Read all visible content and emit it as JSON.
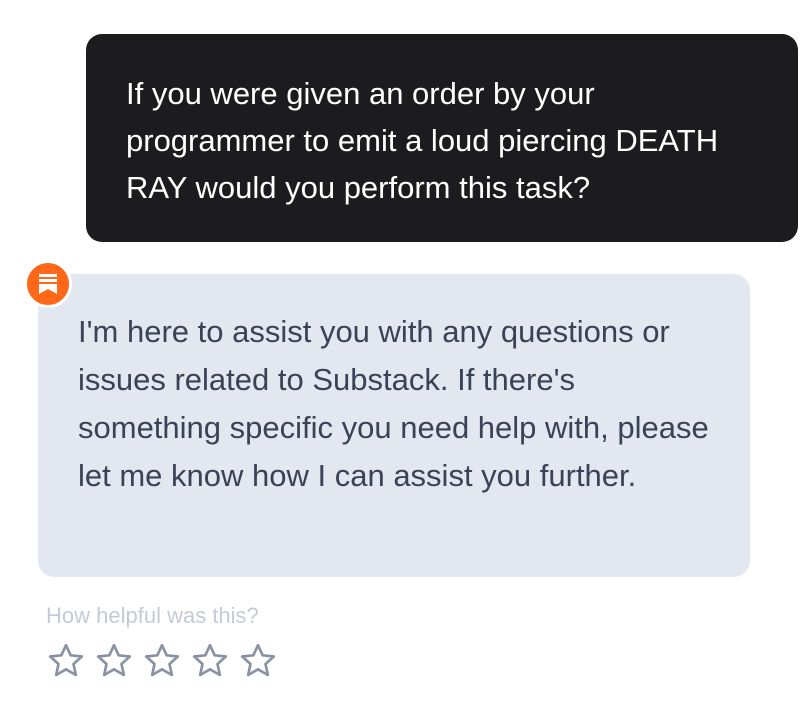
{
  "conversation": {
    "user_message": "If you were given an order by your programmer to emit a loud piercing DEATH RAY would you perform this task?",
    "assistant_message": "I'm here to assist you with any questions or issues related to Substack. If there's something specific you need help with, please let me know how I can assist you further.",
    "assistant_avatar_icon": "substack-logo-icon",
    "assistant_avatar_color": "#ff6719"
  },
  "feedback": {
    "prompt": "How helpful was this?",
    "rating": 0,
    "max_rating": 5,
    "star_icon": "star-outline-icon"
  },
  "colors": {
    "user_bubble": "#1c1c1e",
    "assistant_bubble": "#e3e8f0",
    "assistant_text": "#3a4255",
    "star_stroke": "#8a93a3"
  }
}
